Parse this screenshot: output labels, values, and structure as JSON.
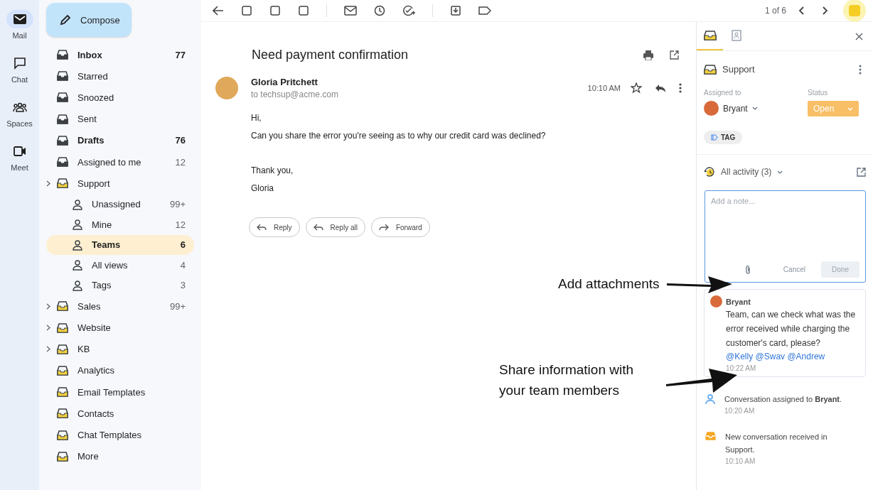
{
  "rail": [
    {
      "label": "Mail",
      "selected": true
    },
    {
      "label": "Chat",
      "selected": false
    },
    {
      "label": "Spaces",
      "selected": false
    },
    {
      "label": "Meet",
      "selected": false
    }
  ],
  "compose": {
    "label": "Compose"
  },
  "nav": [
    {
      "label": "Inbox",
      "count": "77",
      "bold": true,
      "selected": false,
      "collapsible": false
    },
    {
      "label": "Starred",
      "bold": false,
      "selected": false,
      "collapsible": false
    },
    {
      "label": "Snoozed",
      "bold": false,
      "selected": false,
      "collapsible": false
    },
    {
      "label": "Sent",
      "bold": false,
      "selected": false,
      "collapsible": false
    },
    {
      "label": "Drafts",
      "count": "76",
      "bold": true,
      "selected": false,
      "collapsible": false
    },
    {
      "label": "Assigned to me",
      "count": "12",
      "bold": false,
      "selected": false,
      "collapsible": false
    },
    {
      "label": "Support",
      "bold": false,
      "selected": false,
      "collapsible": true,
      "children": [
        {
          "label": "Unassigned",
          "count": "99+",
          "bold": false,
          "selected": false
        },
        {
          "label": "Mine",
          "count": "12",
          "bold": false,
          "selected": false
        },
        {
          "label": "Teams",
          "count": "6",
          "bold": true,
          "selected": true
        },
        {
          "label": "All views",
          "count": "4",
          "bold": false,
          "selected": false
        },
        {
          "label": "Tags",
          "count": "3",
          "bold": false,
          "selected": false
        }
      ]
    },
    {
      "label": "Sales",
      "count": "99+",
      "bold": false,
      "selected": false,
      "collapsible": true
    },
    {
      "label": "Website",
      "bold": false,
      "selected": false,
      "collapsible": true
    },
    {
      "label": "KB",
      "bold": false,
      "selected": false,
      "collapsible": true
    },
    {
      "label": "Analytics",
      "bold": false,
      "selected": false,
      "collapsible": false
    },
    {
      "label": "Email Templates",
      "bold": false,
      "selected": false,
      "collapsible": false
    },
    {
      "label": "Contacts",
      "bold": false,
      "selected": false,
      "collapsible": false
    },
    {
      "label": "Chat Templates",
      "bold": false,
      "selected": false,
      "collapsible": false
    },
    {
      "label": "More",
      "bold": false,
      "selected": false,
      "collapsible": false
    }
  ],
  "pager": "1 of 6",
  "message": {
    "subject": "Need payment confirmation",
    "sender": "Gloria Pritchett",
    "to": "to techsup@acme.com",
    "time": "10:10 AM",
    "body": [
      [
        "Hi,",
        "Can you share the error you're seeing as to why our credit card was declined?"
      ],
      [
        "Thank you,",
        "Gloria"
      ]
    ],
    "actions": [
      "Reply",
      "Reply all",
      "Forward"
    ]
  },
  "panel": {
    "tabs": [
      {
        "selected": true
      },
      {
        "selected": false
      }
    ],
    "inbox": "Support",
    "assigned_label": "Assigned to",
    "assignee": "Bryant",
    "status_label": "Status",
    "status": "Open",
    "tag": "TAG",
    "activity_title": "All activity (3)",
    "note": {
      "placeholder": "Add a note...",
      "cancel": "Cancel",
      "done": "Done",
      "done_disabled": true
    },
    "comment": {
      "author": "Bryant",
      "text": "Team, can we check what was the error received while charging the customer's card, please?",
      "mentions": "@Kelly @Swav @Andrew",
      "time": "10:22 AM"
    },
    "events": [
      {
        "text": "Conversation assigned to **Bryant**.",
        "time": "10:20 AM",
        "color": "#4a9cf0"
      },
      {
        "text": "New conversation received in Support.",
        "time": "10:10 AM",
        "color": "#f5a623"
      }
    ]
  },
  "callouts": [
    {
      "text": "Add attachments"
    },
    {
      "text": "Share information with your team members"
    }
  ]
}
